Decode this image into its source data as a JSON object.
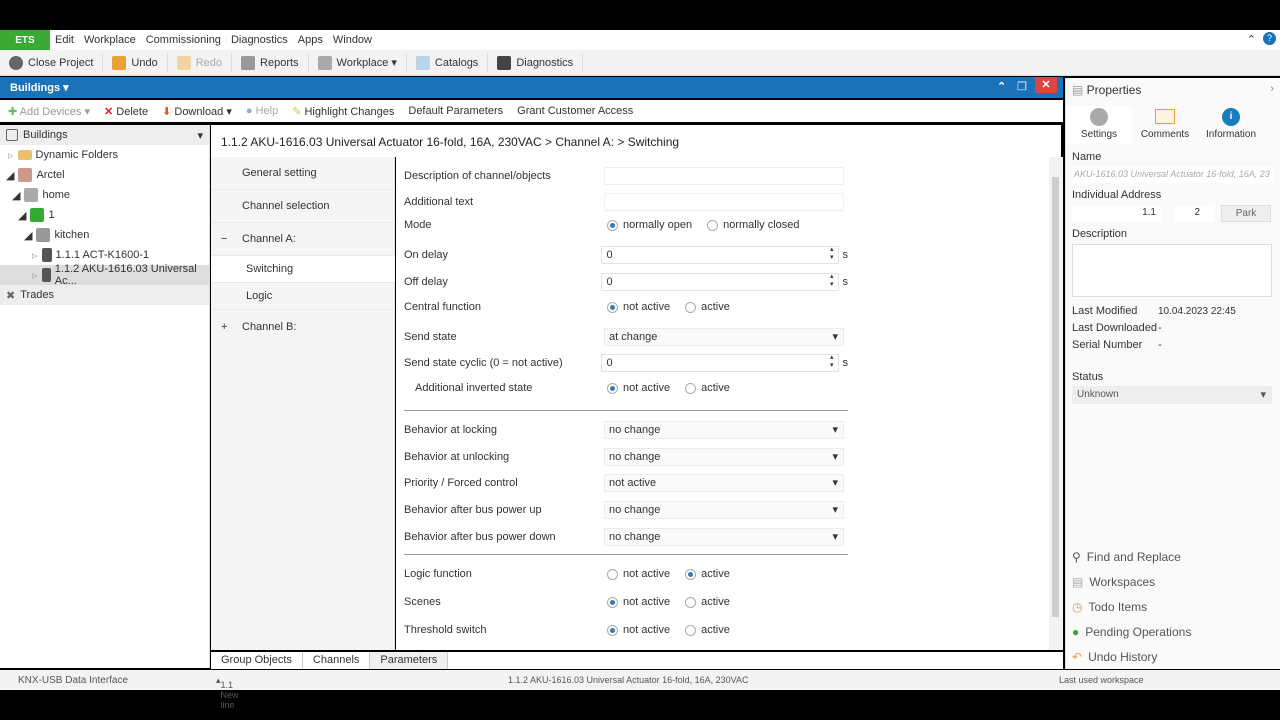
{
  "menu": {
    "logo": "ETS",
    "items": [
      "Edit",
      "Workplace",
      "Commissioning",
      "Diagnostics",
      "Apps",
      "Window"
    ]
  },
  "toolbar": {
    "close_project": "Close Project",
    "undo": "Undo",
    "redo": "Redo",
    "reports": "Reports",
    "workplace": "Workplace ▾",
    "catalogs": "Catalogs",
    "diagnostics": "Diagnostics"
  },
  "panel": {
    "title": "Buildings ▾"
  },
  "toolbar2": {
    "add_devices": "Add Devices",
    "delete": "Delete",
    "download": "Download",
    "help": "Help",
    "highlight": "Highlight Changes",
    "defaults": "Default Parameters",
    "grant": "Grant Customer Access"
  },
  "tree": {
    "header": "Buildings",
    "items": [
      "Dynamic Folders",
      "Arctel",
      "home",
      "1",
      "kitchen",
      "1.1.1 ACT-K1600-1",
      "1.1.2 AKU-1616.03 Universal Ac..."
    ],
    "trades": "Trades"
  },
  "breadcrumb": "1.1.2 AKU-1616.03 Universal Actuator 16-fold, 16A, 230VAC > Channel A:  > Switching",
  "nav": {
    "items": [
      "General setting",
      "Channel selection",
      "Channel A:",
      "Switching",
      "Logic",
      "Channel B:"
    ],
    "collapse": "−",
    "expand": "+"
  },
  "params": {
    "desc": "Description of channel/objects",
    "addtext": "Additional text",
    "mode": "Mode",
    "normally_open": "normally open",
    "normally_closed": "normally closed",
    "on_delay": "On delay",
    "on_val": "0",
    "off_delay": "Off delay",
    "off_val": "0",
    "unit": "s",
    "central": "Central function",
    "not_active": "not active",
    "active": "active",
    "send_state": "Send state",
    "send_state_val": "at change",
    "cyclic": "Send state cyclic (0 = not active)",
    "cyclic_val": "0",
    "inverted": "Additional inverted state",
    "locking": "Behavior at locking",
    "locking_val": "no change",
    "unlocking": "Behavior at unlocking",
    "unlocking_val": "no change",
    "priority": "Priority / Forced control",
    "priority_val": "not active",
    "busup": "Behavior after bus power up",
    "busup_val": "no change",
    "busdown": "Behavior after bus power down",
    "busdown_val": "no change",
    "logic": "Logic function",
    "scenes": "Scenes",
    "threshold": "Threshold switch"
  },
  "bottom_tabs": [
    "Group Objects",
    "Channels",
    "Parameters"
  ],
  "properties": {
    "title": "Properties",
    "tabs": [
      "Settings",
      "Comments",
      "Information"
    ],
    "name_label": "Name",
    "name": "AKU-1616.03 Universal Actuator 16-fold, 16A, 23",
    "addr_label": "Individual Address",
    "addr1": "1.1",
    "addr2": "2",
    "park": "Park",
    "desc_label": "Description",
    "last_modified": "Last Modified",
    "last_modified_val": "10.04.2023 22:45",
    "last_downloaded": "Last Downloaded",
    "last_downloaded_val": "-",
    "serial": "Serial Number",
    "serial_val": "-",
    "status_label": "Status",
    "status": "Unknown",
    "side": [
      "Find and Replace",
      "Workspaces",
      "Todo Items",
      "Pending Operations",
      "Undo History"
    ]
  },
  "statusbar": {
    "iface": "KNX-USB Data Interface",
    "line": "1.1 New line",
    "device": "1.1.2 AKU-1616.03 Universal Actuator 16-fold, 16A, 230VAC",
    "workspace": "Last used workspace"
  }
}
